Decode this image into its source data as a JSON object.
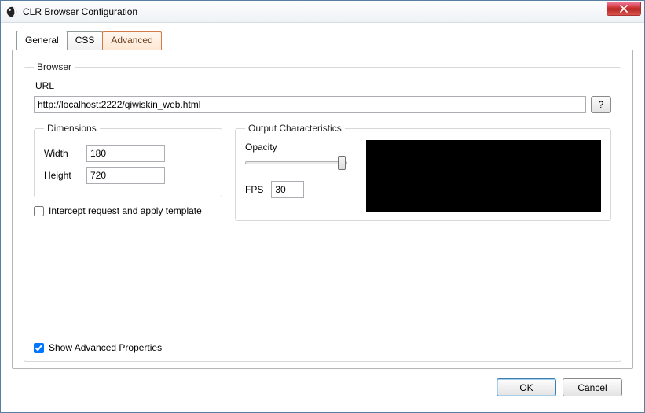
{
  "window": {
    "title": "CLR Browser Configuration"
  },
  "tabs": {
    "general": "General",
    "css": "CSS",
    "advanced": "Advanced",
    "selected": "General"
  },
  "browser": {
    "legend": "Browser",
    "url_label": "URL",
    "url_value": "http://localhost:2222/qiwiskin_web.html",
    "help_label": "?"
  },
  "dimensions": {
    "legend": "Dimensions",
    "width_label": "Width",
    "width_value": "180",
    "height_label": "Height",
    "height_value": "720"
  },
  "intercept": {
    "checked": false,
    "label": "Intercept request and apply template"
  },
  "output": {
    "legend": "Output Characteristics",
    "opacity_label": "Opacity",
    "opacity_value": 100,
    "fps_label": "FPS",
    "fps_value": "30"
  },
  "show_advanced": {
    "checked": true,
    "label": "Show Advanced Properties"
  },
  "buttons": {
    "ok": "OK",
    "cancel": "Cancel"
  }
}
